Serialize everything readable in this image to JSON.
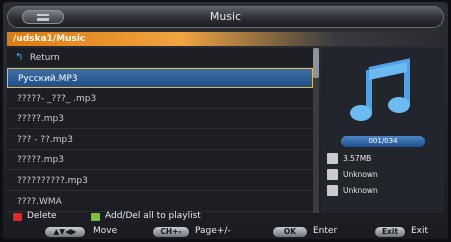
{
  "window": {
    "title": "Music"
  },
  "path": "/udska1/Music",
  "file_list": {
    "return_label": "Return",
    "items": [
      {
        "name": "Русский.MP3",
        "selected": true
      },
      {
        "name": "?????- _???_ .mp3"
      },
      {
        "name": "?????.mp3"
      },
      {
        "name": "??? - ??.mp3"
      },
      {
        "name": "?????.mp3"
      },
      {
        "name": "??????????.mp3"
      },
      {
        "name": "????.WMA"
      }
    ]
  },
  "info": {
    "counter": "001/034",
    "size": "3.57MB",
    "artist": "Unknown",
    "album": "Unknown"
  },
  "legend": {
    "red_label": "Delete",
    "green_label": "Add/Del all to playlist"
  },
  "keys": {
    "arrows_label": "Move",
    "ch_key": "CH+-",
    "ch_label": "Page+/-",
    "ok_key": "OK",
    "ok_label": "Enter",
    "exit_key": "Exit",
    "exit_label": "Exit"
  },
  "colors": {
    "red_button": "#e02828",
    "green_button": "#7cc23a",
    "selection": "#2e5f98",
    "path_accent": "#e88a1c"
  }
}
